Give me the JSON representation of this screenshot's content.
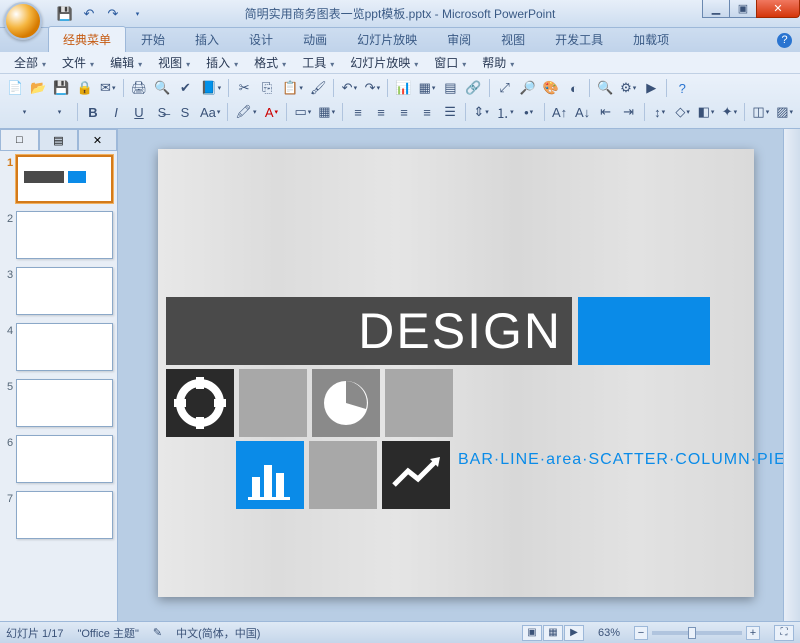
{
  "title": "简明实用商务图表一览ppt模板.pptx - Microsoft PowerPoint",
  "qat": {
    "save": "save-icon",
    "undo": "undo-icon",
    "redo": "redo-icon"
  },
  "tabs": [
    "经典菜单",
    "开始",
    "插入",
    "设计",
    "动画",
    "幻灯片放映",
    "审阅",
    "视图",
    "开发工具",
    "加载项"
  ],
  "active_tab": 0,
  "menubar": [
    "全部",
    "文件",
    "编辑",
    "视图",
    "插入",
    "格式",
    "工具",
    "幻灯片放映",
    "窗口",
    "帮助"
  ],
  "thumbs": {
    "count": 7,
    "selected": 1,
    "tabs": [
      "□",
      "▤",
      "✕"
    ]
  },
  "slide": {
    "heading": "DESIGN",
    "caption": "BAR·LINE·area·SCATTER·COLUMN·PIE·ETC."
  },
  "status": {
    "slide_counter": "幻灯片 1/17",
    "theme": "\"Office 主题\"",
    "lang": "中文(简体，中国)",
    "zoom": "63%"
  },
  "icons": {
    "min": "▁",
    "max": "▣",
    "close": "✕",
    "help": "?"
  }
}
